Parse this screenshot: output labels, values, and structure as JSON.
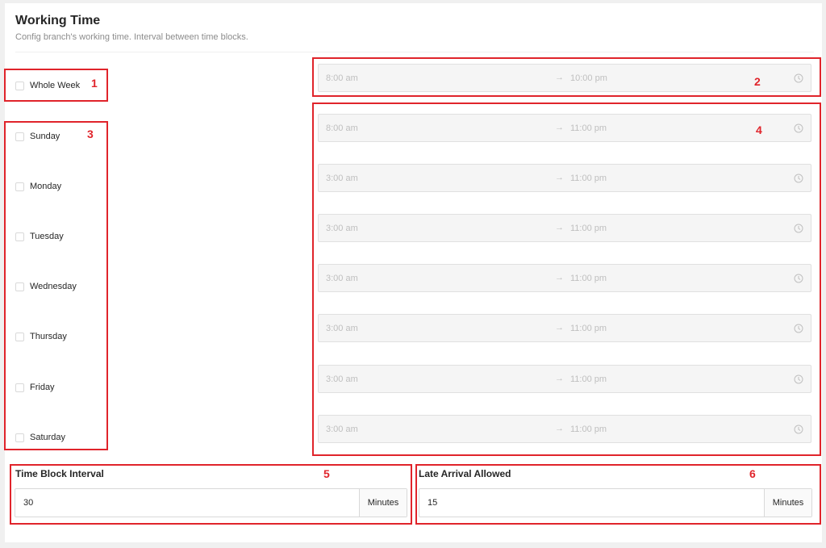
{
  "header": {
    "title": "Working Time",
    "subtitle": "Config branch's working time. Interval between time blocks."
  },
  "whole_week": {
    "label": "Whole Week",
    "checked": false,
    "range": {
      "start": "8:00 am",
      "end": "10:00 pm"
    }
  },
  "days": [
    {
      "label": "Sunday",
      "start": "8:00 am",
      "end": "11:00 pm"
    },
    {
      "label": "Monday",
      "start": "3:00 am",
      "end": "11:00 pm"
    },
    {
      "label": "Tuesday",
      "start": "3:00 am",
      "end": "11:00 pm"
    },
    {
      "label": "Wednesday",
      "start": "3:00 am",
      "end": "11:00 pm"
    },
    {
      "label": "Thursday",
      "start": "3:00 am",
      "end": "11:00 pm"
    },
    {
      "label": "Friday",
      "start": "3:00 am",
      "end": "11:00 pm"
    },
    {
      "label": "Saturday",
      "start": "3:00 am",
      "end": "11:00 pm"
    }
  ],
  "range_arrow": "→",
  "time_block_interval": {
    "label": "Time Block Interval",
    "value": "30",
    "unit": "Minutes"
  },
  "late_arrival": {
    "label": "Late Arrival Allowed",
    "value": "15",
    "unit": "Minutes"
  },
  "annotations": [
    "1",
    "2",
    "3",
    "4",
    "5",
    "6"
  ],
  "icons": {
    "range_clock": "clock-icon",
    "range_arrow": "arrow-right-icon"
  },
  "colors": {
    "annotation_red": "#e0242b",
    "disabled_text": "#bfbfbf",
    "disabled_bg": "#f5f5f5"
  }
}
